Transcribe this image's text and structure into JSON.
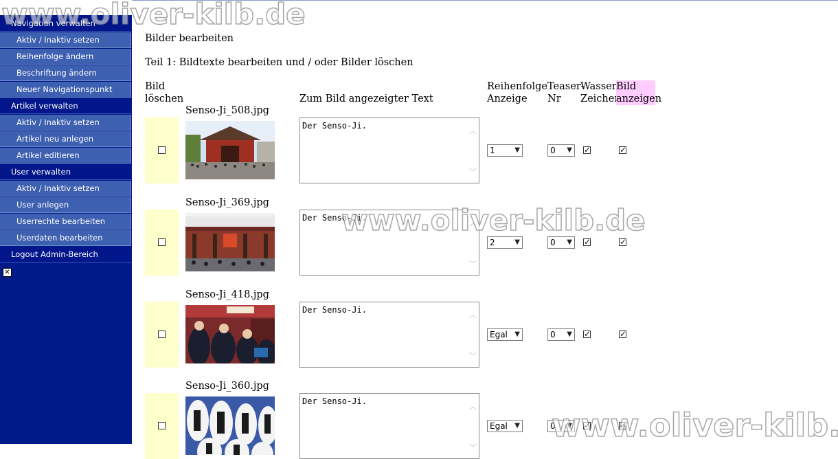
{
  "sidebar": {
    "items": [
      {
        "label": "Navigation verwalten",
        "type": "head"
      },
      {
        "label": "Aktiv / Inaktiv setzen",
        "type": "sub"
      },
      {
        "label": "Reihenfolge ändern",
        "type": "sub"
      },
      {
        "label": "Beschriftung ändern",
        "type": "sub"
      },
      {
        "label": "Neuer Navigationspunkt",
        "type": "sub"
      },
      {
        "label": "Artikel verwalten",
        "type": "head"
      },
      {
        "label": "Aktiv / Inaktiv setzen",
        "type": "sub"
      },
      {
        "label": "Artikel neu anlegen",
        "type": "sub"
      },
      {
        "label": "Artikel editieren",
        "type": "sub"
      },
      {
        "label": "User verwalten",
        "type": "head"
      },
      {
        "label": "Aktiv / Inaktiv setzen",
        "type": "sub"
      },
      {
        "label": "User anlegen",
        "type": "sub"
      },
      {
        "label": "Userrechte bearbeiten",
        "type": "sub"
      },
      {
        "label": "Userdaten bearbeiten",
        "type": "sub"
      },
      {
        "label": "Logout Admin-Bereich",
        "type": "head"
      }
    ],
    "close_icon": "close-box-icon"
  },
  "main": {
    "title": "Bilder bearbeiten",
    "subtitle": "Teil 1: Bildtexte bearbeiten und / oder Bilder löschen",
    "headers": {
      "delete_1": "Bild",
      "delete_2": "löschen",
      "text": "Zum Bild angezeigter Text",
      "order_1": "Reihenfolge",
      "order_2": "Anzeige",
      "teaser_1": "Teaser-",
      "teaser_2": "Nr",
      "water_1": "Wasser-",
      "water_2": "Zeichen",
      "show_1": "Bild",
      "show_2": "anzeigen"
    },
    "rows": [
      {
        "filename": "Senso-Ji_508.jpg",
        "text": "Der Senso-Ji.",
        "order": "1",
        "teaser": "0",
        "watermark": true,
        "show": true,
        "delete": false
      },
      {
        "filename": "Senso-Ji_369.jpg",
        "text": "Der Senso-Ji.",
        "order": "2",
        "teaser": "0",
        "watermark": true,
        "show": true,
        "delete": false
      },
      {
        "filename": "Senso-Ji_418.jpg",
        "text": "Der Senso-Ji.",
        "order": "Egal",
        "teaser": "0",
        "watermark": true,
        "show": true,
        "delete": false
      },
      {
        "filename": "Senso-Ji_360.jpg",
        "text": "Der Senso-Ji.",
        "order": "Egal",
        "teaser": "0",
        "watermark": true,
        "show": true,
        "delete": false
      }
    ]
  },
  "watermark": "www.oliver-kilb.de",
  "colors": {
    "sidebar_bg": "#001a8a",
    "sidebar_sub_bg": "#3e60b0",
    "delete_cell_bg": "#ffffcc",
    "show_header_bg": "#ffccff"
  }
}
